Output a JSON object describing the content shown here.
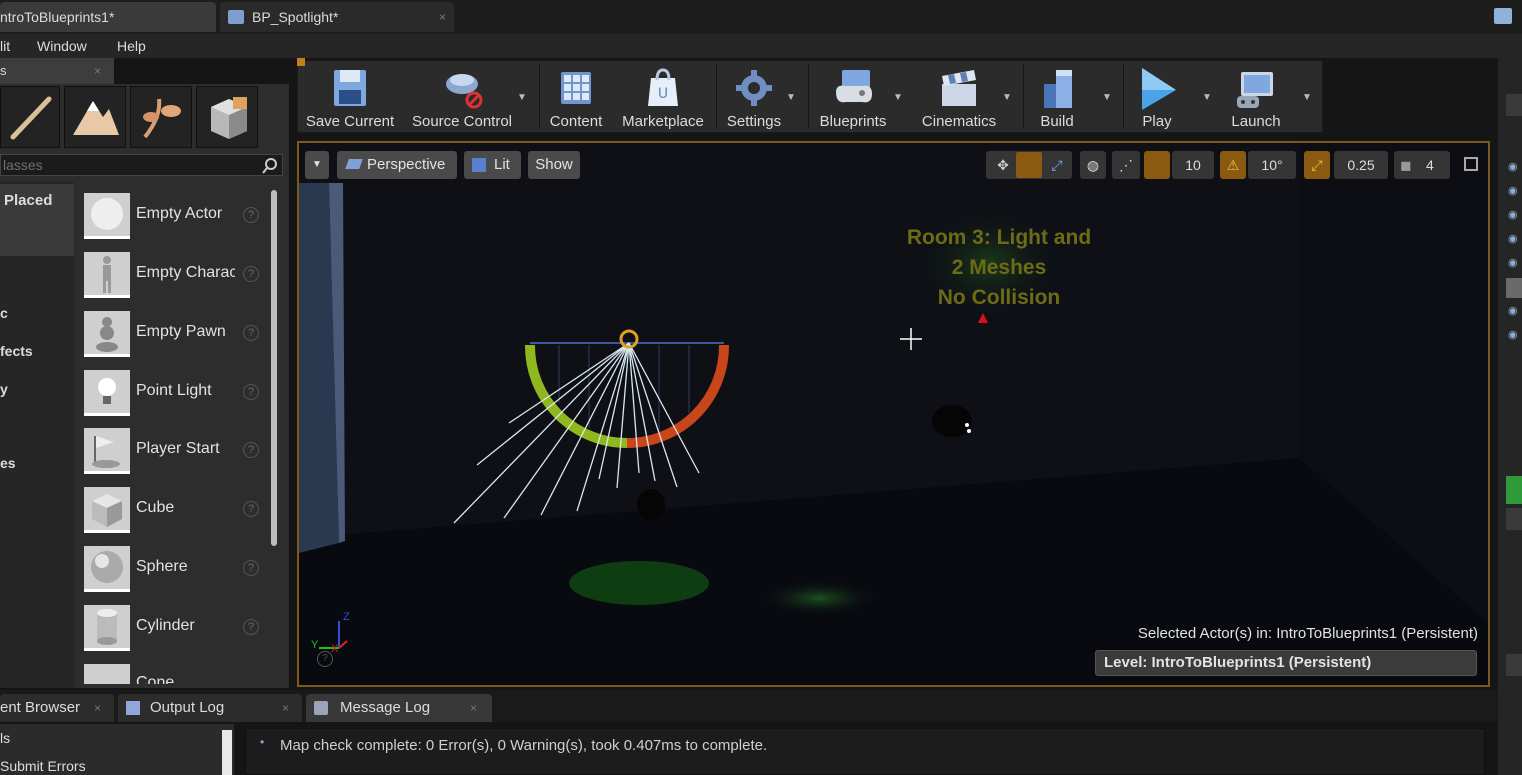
{
  "doc_tabs": [
    {
      "label": "ntroToBlueprints1*"
    },
    {
      "label": "BP_Spotlight*"
    }
  ],
  "menu": [
    "lit",
    "Window",
    "Help"
  ],
  "modes": {
    "tab_label": "s",
    "search_placeholder": "lasses",
    "categories": [
      {
        "label": "Placed"
      },
      {
        "label": "c"
      },
      {
        "label": "fects"
      },
      {
        "label": "y"
      },
      {
        "label": "es"
      }
    ],
    "items": [
      {
        "label": "Empty Actor"
      },
      {
        "label": "Empty Charac"
      },
      {
        "label": "Empty Pawn"
      },
      {
        "label": "Point Light"
      },
      {
        "label": "Player Start"
      },
      {
        "label": "Cube"
      },
      {
        "label": "Sphere"
      },
      {
        "label": "Cylinder"
      },
      {
        "label": "Cone"
      }
    ]
  },
  "toolbar": {
    "save": "Save Current",
    "source_control": "Source Control",
    "content": "Content",
    "marketplace": "Marketplace",
    "settings": "Settings",
    "blueprints": "Blueprints",
    "cinematics": "Cinematics",
    "build": "Build",
    "play": "Play",
    "launch": "Launch"
  },
  "viewport": {
    "perspective": "Perspective",
    "lit": "Lit",
    "show": "Show",
    "grid_snap": "10",
    "rot_snap": "10°",
    "scale_snap": "0.25",
    "camera_speed": "4",
    "room_text": [
      "Room 3: Light and",
      "2 Meshes",
      "No Collision"
    ],
    "selected_actor": "Selected Actor(s) in:  IntroToBlueprints1 (Persistent)",
    "level": "Level:  IntroToBlueprints1 (Persistent)",
    "axis_z": "Z",
    "axis_x": "X",
    "axis_y": "Y"
  },
  "bottom_tabs": [
    {
      "label": "ent Browser"
    },
    {
      "label": "Output Log"
    },
    {
      "label": "Message Log"
    }
  ],
  "log": {
    "left_items": [
      "ls",
      "Submit Errors"
    ],
    "message": "Map check complete: 0 Error(s), 0 Warning(s), took 0.407ms to complete."
  },
  "colors": {
    "accent_orange": "#c8781a",
    "play_blue": "#4aa3e8",
    "viewport_border": "#7a5a1a"
  }
}
